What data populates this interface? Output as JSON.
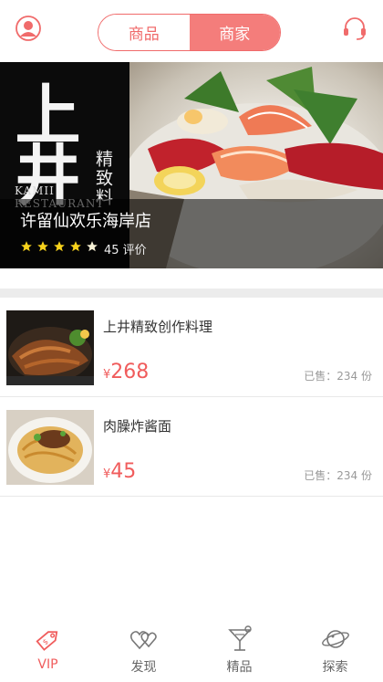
{
  "header": {
    "tabs": [
      {
        "label": "商品",
        "active": false
      },
      {
        "label": "商家",
        "active": true
      }
    ],
    "left_icon": "user-icon",
    "right_icon": "headset-icon"
  },
  "banner": {
    "logo_text": "上井",
    "logo_sub": "精致料",
    "logo_en": "KAMII RESTAURANT",
    "shop_name": "许留仙欢乐海岸店",
    "rating": 5,
    "reviews": "45 评价"
  },
  "products": [
    {
      "name": "上井精致创作料理",
      "currency": "¥",
      "price": "268",
      "sold": "已售：234 份"
    },
    {
      "name": "肉臊炸酱面",
      "currency": "¥",
      "price": "45",
      "sold": "已售：234 份"
    }
  ],
  "nav": [
    {
      "label": "VIP",
      "icon": "vip-tag-icon",
      "active": true
    },
    {
      "label": "发现",
      "icon": "hearts-icon",
      "active": false
    },
    {
      "label": "精品",
      "icon": "cocktail-icon",
      "active": false
    },
    {
      "label": "探索",
      "icon": "planet-icon",
      "active": false
    }
  ],
  "colors": {
    "accent": "#f05c5c",
    "tab_active": "#f47d7b"
  }
}
